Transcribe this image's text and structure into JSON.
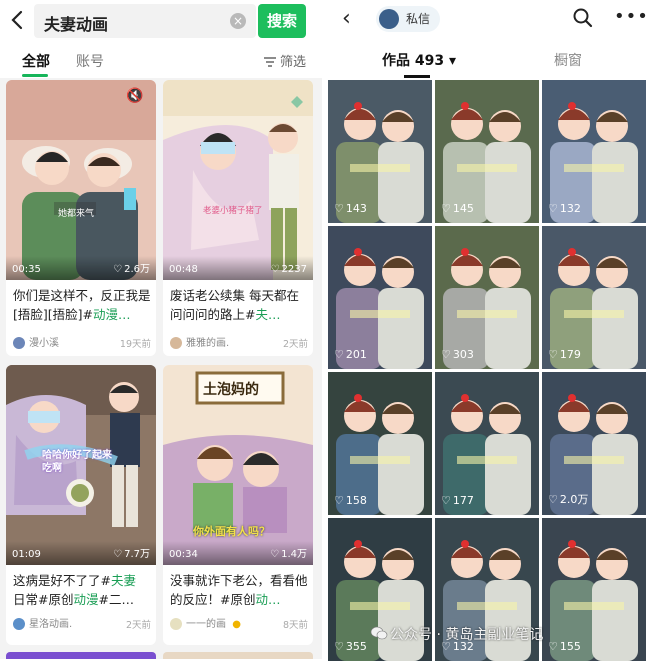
{
  "left": {
    "search": {
      "query": "夫妻动画",
      "clear": "×",
      "button": "搜索"
    },
    "tabs": [
      "全部",
      "账号"
    ],
    "filter": "筛选",
    "cards": [
      {
        "duration": "00:35",
        "likes": "2.6万",
        "overlay": "她都来气",
        "title_prefix": "你们是这样不，反正我是[捂脸][捂脸]#",
        "title_tag": "动漫…",
        "author": "漫小溪",
        "ago": "19天前"
      },
      {
        "duration": "00:48",
        "likes": "2237",
        "overlay": "老婆小猪子猪了",
        "title_prefix": "废话老公续集 每天都在问问问的路上#",
        "title_tag": "夫…",
        "author": "雅雅的画.",
        "ago": "2天前"
      },
      {
        "duration": "01:09",
        "likes": "7.7万",
        "overlay": "哈哈你好了起来吃啊",
        "title_prefix": "这病是好不了了#",
        "title_tag": "夫妻",
        "title_line2_prefix": "日常#原创",
        "title_line2_tag": "动漫",
        "title_line2_rest": "#二…",
        "author": "星洛动画.",
        "ago": "2天前"
      },
      {
        "duration": "00:34",
        "likes": "1.4万",
        "overlay": "你外面有人吗？",
        "banner": "土泡妈的",
        "title_prefix": "没事就诈下老公，看看他的反应！#原创",
        "title_tag": "动…",
        "author": "一一的画",
        "ago": "8天前"
      }
    ]
  },
  "right": {
    "back": "‹",
    "dm_label": "私信",
    "more": "•••",
    "tabs": {
      "works": "作品 493 ▾",
      "shop": "橱窗"
    },
    "cells": [
      "143",
      "145",
      "132",
      "201",
      "303",
      "179",
      "158",
      "177",
      "2.0万",
      "355",
      "132",
      "155"
    ]
  },
  "watermark": "公众号 · 黄岛主副业笔记",
  "colors": {
    "accent": "#1dbe5d",
    "tag": "#1a9e55"
  }
}
